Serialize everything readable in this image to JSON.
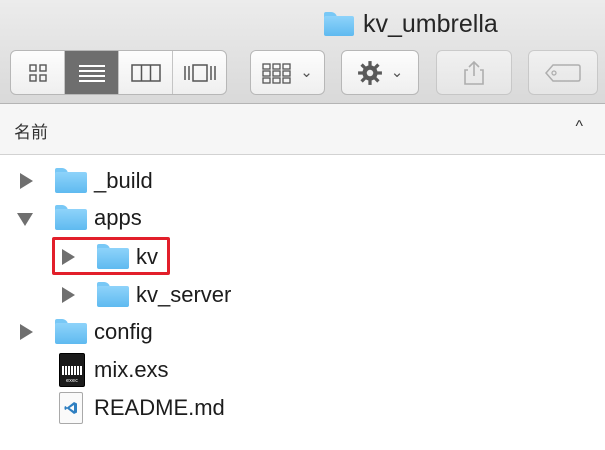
{
  "window": {
    "title": "kv_umbrella",
    "title_icon": "folder-icon"
  },
  "toolbar": {
    "view_modes": [
      {
        "name": "icon-view",
        "icon": "grid-icon",
        "active": false
      },
      {
        "name": "list-view",
        "icon": "list-icon",
        "active": true
      },
      {
        "name": "column-view",
        "icon": "columns-icon",
        "active": false
      },
      {
        "name": "cover-flow-view",
        "icon": "cover-flow-icon",
        "active": false
      }
    ],
    "arrange_icon": "arrange-icon",
    "action_icon": "gear-icon",
    "share_icon": "share-icon",
    "tag_icon": "tag-icon"
  },
  "column_header": {
    "name_label": "名前",
    "sort_indicator": "^"
  },
  "files": [
    {
      "name": "_build",
      "kind": "folder",
      "disclosure": "collapsed",
      "depth": 0
    },
    {
      "name": "apps",
      "kind": "folder",
      "disclosure": "expanded",
      "depth": 0
    },
    {
      "name": "kv",
      "kind": "folder",
      "disclosure": "collapsed",
      "depth": 1,
      "highlighted": true
    },
    {
      "name": "kv_server",
      "kind": "folder",
      "disclosure": "collapsed",
      "depth": 1
    },
    {
      "name": "config",
      "kind": "folder",
      "disclosure": "collapsed",
      "depth": 0
    },
    {
      "name": "mix.exs",
      "kind": "exec",
      "icon_caption": "exec",
      "depth": 0
    },
    {
      "name": "README.md",
      "kind": "markdown",
      "depth": 0
    }
  ],
  "colors": {
    "folder": "#6cc3f5",
    "highlight": "#e21f2a",
    "active_segment": "#6e6e6e"
  }
}
